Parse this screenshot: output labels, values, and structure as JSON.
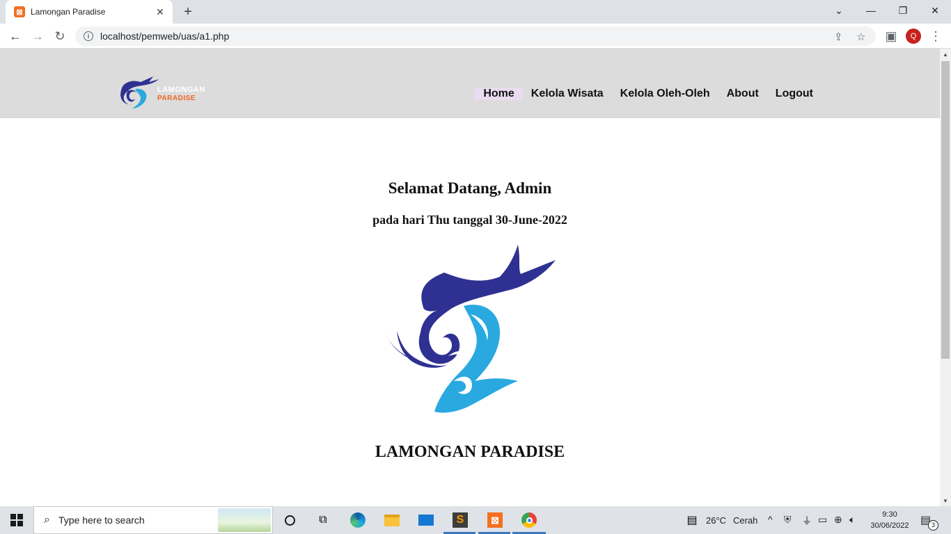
{
  "browser": {
    "tab_title": "Lamongan Paradise",
    "url": "localhost/pemweb/uas/a1.php",
    "profile_initial": "Q"
  },
  "site": {
    "logo_line1": "LAMONGAN",
    "logo_line2": "PARADISE",
    "menu": [
      {
        "label": "Home",
        "active": true
      },
      {
        "label": "Kelola Wisata"
      },
      {
        "label": "Kelola Oleh-Oleh"
      },
      {
        "label": "About"
      },
      {
        "label": "Logout"
      }
    ]
  },
  "main": {
    "welcome": "Selamat Datang, Admin",
    "date_line": "pada hari Thu tanggal 30-June-2022",
    "brand": "LAMONGAN PARADISE"
  },
  "taskbar": {
    "search_placeholder": "Type here to search",
    "weather_temp": "26°C",
    "weather_desc": "Cerah",
    "time": "9:30",
    "date": "30/06/2022",
    "notification_count": "3"
  },
  "colors": {
    "header_bg": "#dcdcdc",
    "logo_navy": "#2e3192",
    "logo_blue": "#29a9e0",
    "logo_orange": "#f26522",
    "active_menu_bg": "#eadcf0"
  }
}
